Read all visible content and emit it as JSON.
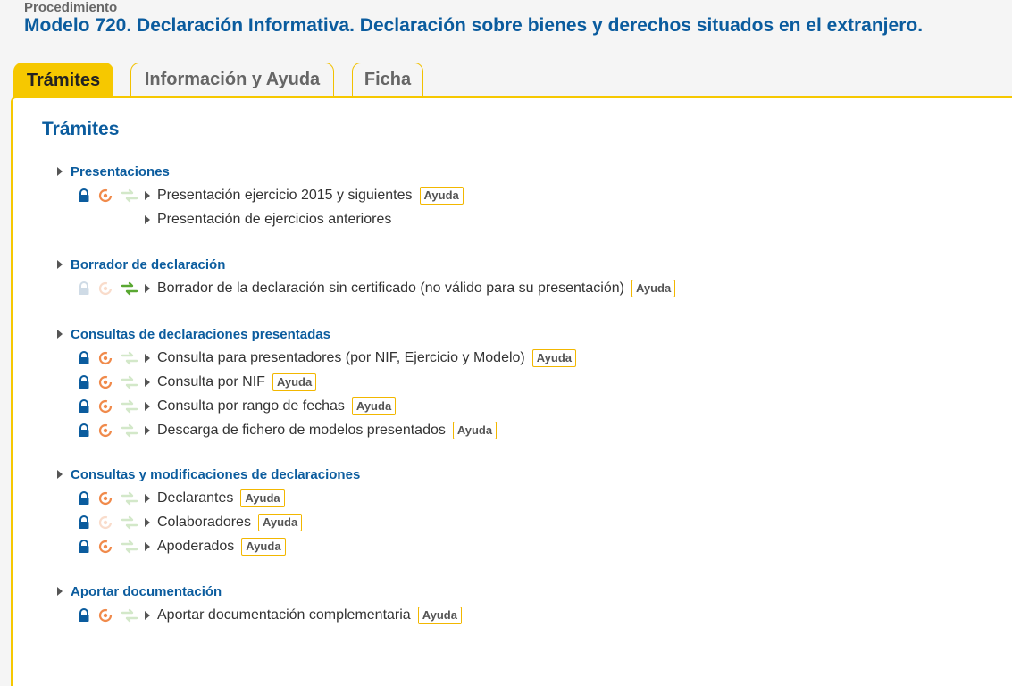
{
  "header": {
    "label": "Procedimiento",
    "title": "Modelo 720. Declaración Informativa. Declaración sobre bienes y derechos situados en el extranjero."
  },
  "tabs": [
    {
      "label": "Trámites"
    },
    {
      "label": "Información y Ayuda"
    },
    {
      "label": "Ficha"
    }
  ],
  "panel_title": "Trámites",
  "help_label": "Ayuda",
  "colors": {
    "accent": "#f6c800",
    "link": "#0b5c9e",
    "lock": "#0b5c9e",
    "cert": "#f08a4b",
    "transfer": "#5aa832"
  },
  "icons": {
    "lock": "lock-icon",
    "certificate": "certificate-icon",
    "transfer": "transfer-arrows-icon"
  },
  "sections": [
    {
      "title": "Presentaciones",
      "items": [
        {
          "label": "Presentación ejercicio 2015 y siguientes",
          "help": true,
          "icons": "full"
        },
        {
          "label": "Presentación de ejercicios anteriores",
          "help": false,
          "icons": "none"
        }
      ]
    },
    {
      "title": "Borrador de declaración",
      "items": [
        {
          "label": "Borrador de la declaración sin certificado (no válido para su presentación)",
          "help": true,
          "icons": "transfer"
        }
      ]
    },
    {
      "title": "Consultas de declaraciones presentadas",
      "items": [
        {
          "label": "Consulta para presentadores (por NIF, Ejercicio y Modelo)",
          "help": true,
          "icons": "full"
        },
        {
          "label": "Consulta por NIF",
          "help": true,
          "icons": "full"
        },
        {
          "label": "Consulta por rango de fechas",
          "help": true,
          "icons": "full"
        },
        {
          "label": "Descarga de fichero de modelos presentados",
          "help": true,
          "icons": "full"
        }
      ]
    },
    {
      "title": "Consultas y modificaciones de declaraciones",
      "items": [
        {
          "label": "Declarantes",
          "help": true,
          "icons": "full"
        },
        {
          "label": "Colaboradores",
          "help": true,
          "icons": "lock"
        },
        {
          "label": "Apoderados",
          "help": true,
          "icons": "full"
        }
      ]
    },
    {
      "title": "Aportar documentación",
      "items": [
        {
          "label": "Aportar documentación complementaria",
          "help": true,
          "icons": "full"
        }
      ]
    }
  ]
}
